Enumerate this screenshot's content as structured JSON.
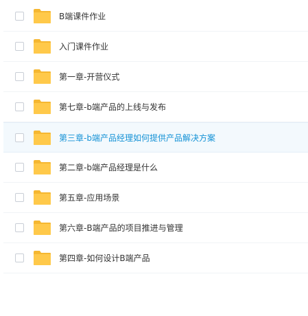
{
  "files": [
    {
      "name": "B端课件作业"
    },
    {
      "name": "入门课件作业"
    },
    {
      "name": "第一章-开营仪式"
    },
    {
      "name": "第七章-b端产品的上线与发布"
    },
    {
      "name": "第三章-b端产品经理如何提供产品解决方案",
      "highlighted": true
    },
    {
      "name": "第二章-b端产品经理是什么"
    },
    {
      "name": "第五章-应用场景"
    },
    {
      "name": "第六章-B端产品的项目推进与管理"
    },
    {
      "name": "第四章-如何设计B端产品"
    }
  ],
  "colors": {
    "folder": "#ffc94a",
    "folder_tab": "#f5b731",
    "highlight_text": "#1592d6",
    "highlight_bg": "#f3f9fd"
  },
  "icons": {
    "row_icon": "folder-icon"
  }
}
